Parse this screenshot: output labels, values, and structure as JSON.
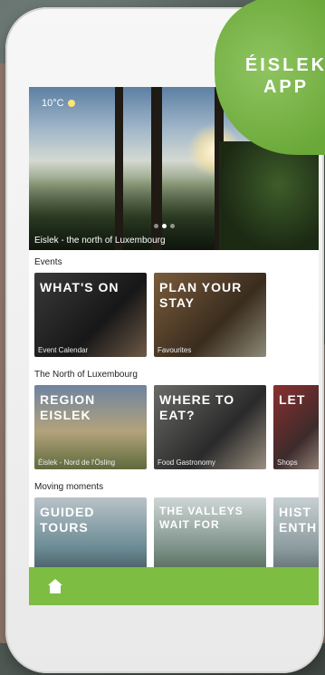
{
  "hero": {
    "weather": "10°C",
    "caption": "Eislek - the north of Luxembourg",
    "dots": 3,
    "active_dot": 2
  },
  "badge": {
    "line1": "ÉISLEK",
    "line2": "APP"
  },
  "sections": [
    {
      "title": "Events",
      "cards": [
        {
          "title": "WHAT'S ON",
          "subtitle": "Event Calendar"
        },
        {
          "title": "PLAN YOUR STAY",
          "subtitle": "Favourites"
        }
      ]
    },
    {
      "title": "The North of Luxembourg",
      "cards": [
        {
          "title": "REGION EISLEK",
          "subtitle": "Éislek - Nord de l'Ösling"
        },
        {
          "title": "WHERE TO EAT?",
          "subtitle": "Food Gastronomy"
        },
        {
          "title": "LET",
          "subtitle": "Shops"
        }
      ]
    },
    {
      "title": "Moving moments",
      "cards": [
        {
          "title": "GUIDED TOURS",
          "subtitle": ""
        },
        {
          "title": "THE VALLEYS WAIT FOR",
          "subtitle": ""
        },
        {
          "title": "HIST ENTH",
          "subtitle": ""
        }
      ]
    }
  ],
  "tabbar": {
    "active_icon": "home-icon",
    "color": "#7dbd42"
  }
}
